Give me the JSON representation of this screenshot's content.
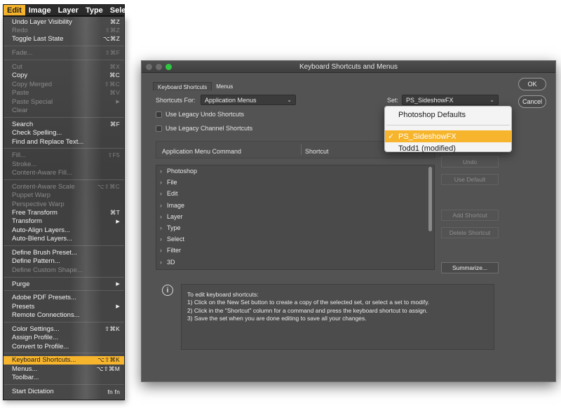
{
  "menubar": {
    "items": [
      "Edit",
      "Image",
      "Layer",
      "Type",
      "Select"
    ]
  },
  "edit_menu": {
    "items": [
      {
        "label": "Undo Layer Visibility",
        "shortcut": "⌘Z",
        "disabled": false
      },
      {
        "label": "Redo",
        "shortcut": "⇧⌘Z",
        "disabled": true
      },
      {
        "label": "Toggle Last State",
        "shortcut": "⌥⌘Z",
        "disabled": false
      },
      {
        "sep": true
      },
      {
        "label": "Fade...",
        "shortcut": "⇧⌘F",
        "disabled": true
      },
      {
        "sep": true
      },
      {
        "label": "Cut",
        "shortcut": "⌘X",
        "disabled": true
      },
      {
        "label": "Copy",
        "shortcut": "⌘C",
        "disabled": false
      },
      {
        "label": "Copy Merged",
        "shortcut": "⇧⌘C",
        "disabled": true
      },
      {
        "label": "Paste",
        "shortcut": "⌘V",
        "disabled": true
      },
      {
        "label": "Paste Special",
        "shortcut": "▶",
        "disabled": true,
        "submenu": true
      },
      {
        "label": "Clear",
        "shortcut": "",
        "disabled": true
      },
      {
        "sep": true
      },
      {
        "label": "Search",
        "shortcut": "⌘F",
        "disabled": false
      },
      {
        "label": "Check Spelling...",
        "shortcut": "",
        "disabled": false
      },
      {
        "label": "Find and Replace Text...",
        "shortcut": "",
        "disabled": false
      },
      {
        "sep": true
      },
      {
        "label": "Fill...",
        "shortcut": "⇧F5",
        "disabled": true
      },
      {
        "label": "Stroke...",
        "shortcut": "",
        "disabled": true
      },
      {
        "label": "Content-Aware Fill...",
        "shortcut": "",
        "disabled": true
      },
      {
        "sep": true
      },
      {
        "label": "Content-Aware Scale",
        "shortcut": "⌥⇧⌘C",
        "disabled": true
      },
      {
        "label": "Puppet Warp",
        "shortcut": "",
        "disabled": true
      },
      {
        "label": "Perspective Warp",
        "shortcut": "",
        "disabled": true
      },
      {
        "label": "Free Transform",
        "shortcut": "⌘T",
        "disabled": false
      },
      {
        "label": "Transform",
        "shortcut": "▶",
        "disabled": false,
        "submenu": true
      },
      {
        "label": "Auto-Align Layers...",
        "shortcut": "",
        "disabled": false
      },
      {
        "label": "Auto-Blend Layers...",
        "shortcut": "",
        "disabled": false
      },
      {
        "sep": true
      },
      {
        "label": "Define Brush Preset...",
        "shortcut": "",
        "disabled": false
      },
      {
        "label": "Define Pattern...",
        "shortcut": "",
        "disabled": false
      },
      {
        "label": "Define Custom Shape...",
        "shortcut": "",
        "disabled": true
      },
      {
        "sep": true
      },
      {
        "label": "Purge",
        "shortcut": "▶",
        "disabled": false,
        "submenu": true
      },
      {
        "sep": true
      },
      {
        "label": "Adobe PDF Presets...",
        "shortcut": "",
        "disabled": false
      },
      {
        "label": "Presets",
        "shortcut": "▶",
        "disabled": false,
        "submenu": true
      },
      {
        "label": "Remote Connections...",
        "shortcut": "",
        "disabled": false
      },
      {
        "sep": true
      },
      {
        "label": "Color Settings...",
        "shortcut": "⇧⌘K",
        "disabled": false
      },
      {
        "label": "Assign Profile...",
        "shortcut": "",
        "disabled": false
      },
      {
        "label": "Convert to Profile...",
        "shortcut": "",
        "disabled": false
      },
      {
        "sep": true
      },
      {
        "label": "Keyboard Shortcuts...",
        "shortcut": "⌥⇧⌘K",
        "disabled": false,
        "selected": true
      },
      {
        "label": "Menus...",
        "shortcut": "⌥⇧⌘M",
        "disabled": false
      },
      {
        "label": "Toolbar...",
        "shortcut": "",
        "disabled": false
      },
      {
        "sep": true
      },
      {
        "label": "Start Dictation",
        "shortcut": "fn fn",
        "disabled": false
      }
    ]
  },
  "dialog": {
    "title": "Keyboard Shortcuts and Menus",
    "tabs": [
      "Keyboard Shortcuts",
      "Menus"
    ],
    "shortcuts_for_label": "Shortcuts For:",
    "shortcuts_for_value": "Application Menus",
    "set_label": "Set:",
    "set_value": "PS_SideshowFX",
    "legacy_undo_label": "Use Legacy Undo Shortcuts",
    "legacy_channel_label": "Use Legacy Channel Shortcuts",
    "col_command": "Application Menu Command",
    "col_shortcut": "Shortcut",
    "commands": [
      "Photoshop",
      "File",
      "Edit",
      "Image",
      "Layer",
      "Type",
      "Select",
      "Filter",
      "3D"
    ],
    "buttons": {
      "ok": "OK",
      "cancel": "Cancel",
      "undo": "Undo",
      "use_default": "Use Default",
      "add_shortcut": "Add Shortcut",
      "delete_shortcut": "Delete Shortcut",
      "summarize": "Summarize..."
    },
    "info_lines": [
      "To edit keyboard shortcuts:",
      "1) Click on the New Set button to create a copy of the selected set, or select a set to modify.",
      "2) Click in the \"Shortcut\" column for a command and press the keyboard shortcut to assign.",
      "3) Save the set when you are done editing to save all your changes."
    ]
  },
  "set_popup": {
    "items": [
      "Photoshop Defaults",
      "PS_SideshowFX",
      "Todd1 (modified)"
    ],
    "checked_index": 1
  },
  "colors": {
    "accent": "#f7b52d",
    "dialog_bg": "#535353",
    "menu_bg": "#444444"
  }
}
